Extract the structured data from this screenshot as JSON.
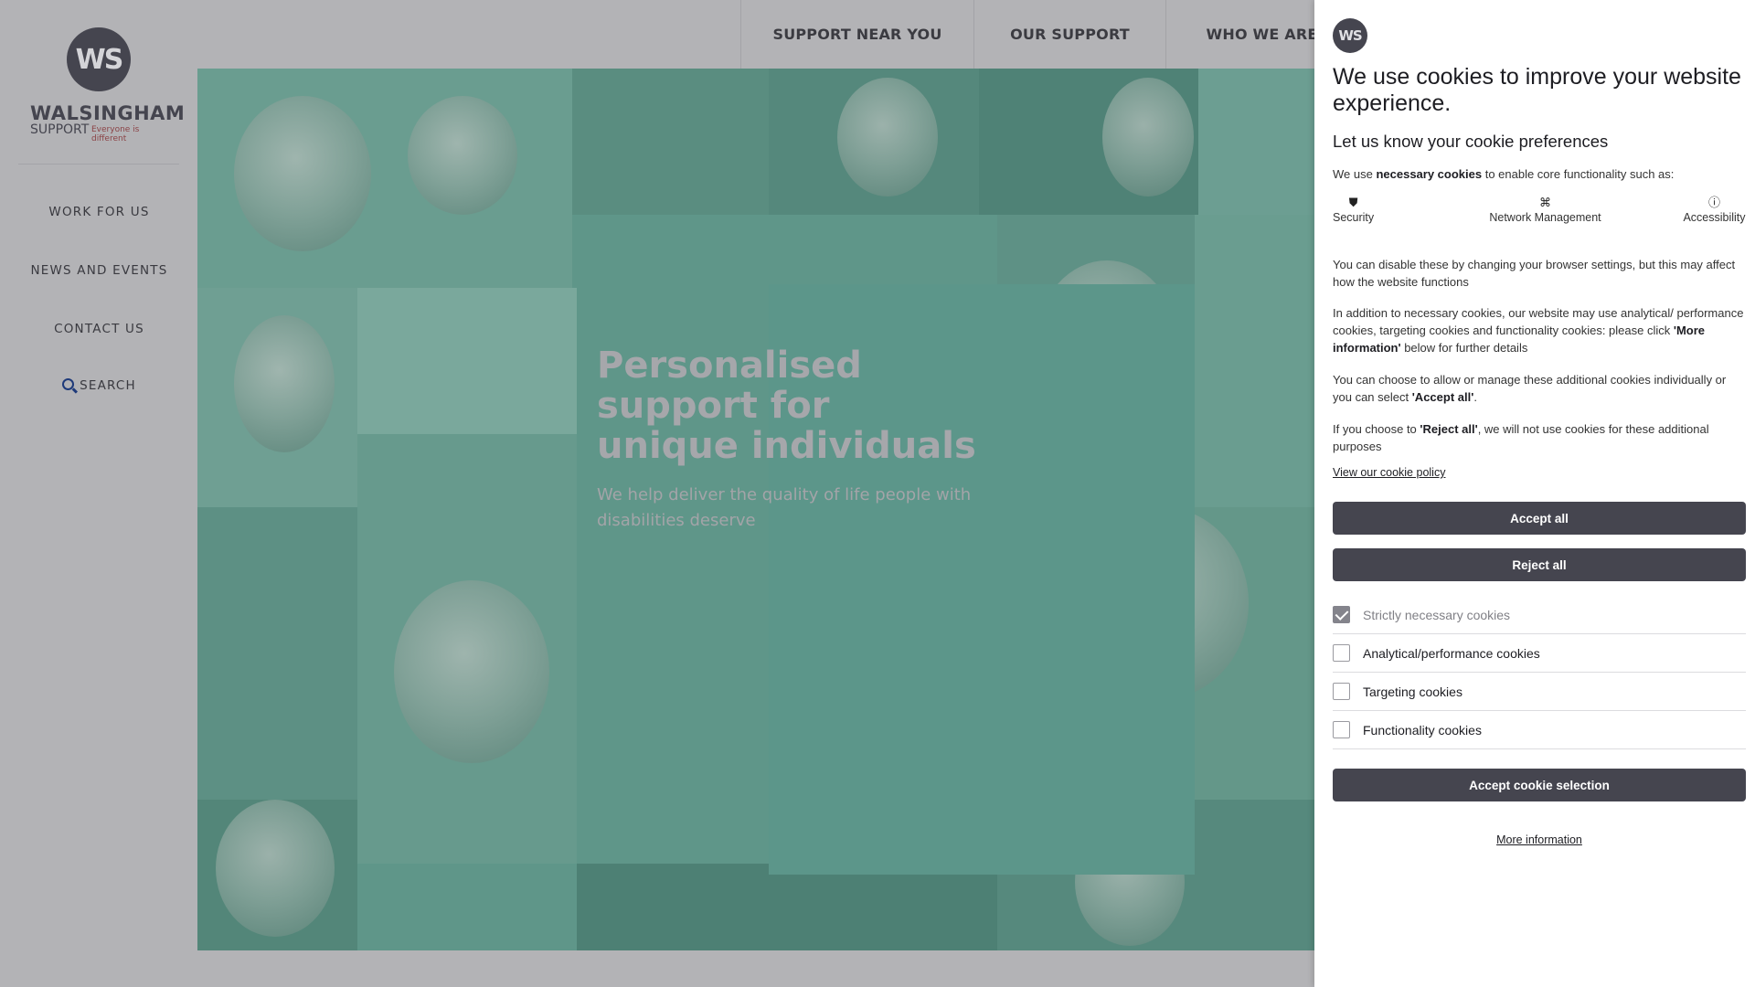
{
  "site": {
    "logo": {
      "initials": "WS",
      "name": "WALSINGHAM",
      "support": "SUPPORT",
      "tagline": "Everyone is different"
    },
    "left_nav": [
      {
        "label": "WORK FOR US"
      },
      {
        "label": "NEWS AND EVENTS"
      },
      {
        "label": "CONTACT US"
      },
      {
        "label": "SEARCH",
        "icon": "search-icon"
      }
    ],
    "top_nav": [
      {
        "label": "SUPPORT NEAR YOU"
      },
      {
        "label": "OUR SUPPORT"
      },
      {
        "label": "WHO WE ARE"
      }
    ],
    "hero": {
      "title": "Personalised support for unique individuals",
      "subtitle": "We help deliver the quality of life people with disabilities deserve"
    }
  },
  "cookie_panel": {
    "logo_initials": "WS",
    "title": "We use cookies to improve your website experience.",
    "subtitle": "Let us know your cookie preferences",
    "intro_prefix": "We use ",
    "intro_bold": "necessary cookies",
    "intro_suffix": " to enable core functionality such as:",
    "features": [
      {
        "label": "Security",
        "icon": "shield-icon"
      },
      {
        "label": "Network Management",
        "icon": "network-icon"
      },
      {
        "label": "Accessibility",
        "icon": "accessibility-icon"
      }
    ],
    "para_disable": "You can disable these by changing your browser settings, but this may affect how the website functions",
    "para_addition_a": "In addition to necessary cookies, our website may use analytical/ performance cookies, targeting cookies and functionality cookies: please click ",
    "para_addition_bold": "'More information'",
    "para_addition_b": " below for further details",
    "para_choose_a": "You can choose to allow or manage these additional cookies individually or you can select ",
    "para_choose_bold": "'Accept all'",
    "para_choose_b": ".",
    "para_reject_a": "If you choose to ",
    "para_reject_bold": "'Reject all'",
    "para_reject_b": ", we will not use cookies for these additional purposes",
    "policy_link": "View our cookie policy",
    "accept_all": "Accept all",
    "reject_all": "Reject all",
    "options": [
      {
        "label": "Strictly necessary cookies",
        "checked": true,
        "disabled": true
      },
      {
        "label": "Analytical/performance cookies",
        "checked": false,
        "disabled": false
      },
      {
        "label": "Targeting cookies",
        "checked": false,
        "disabled": false
      },
      {
        "label": "Functionality cookies",
        "checked": false,
        "disabled": false
      }
    ],
    "accept_selection": "Accept cookie selection",
    "more_info": "More information"
  },
  "colors": {
    "overlay_gray": "#b3b3b6",
    "hero_teal": "#5f9689",
    "button_dark": "#45454f",
    "brand_red": "#8b4346"
  }
}
